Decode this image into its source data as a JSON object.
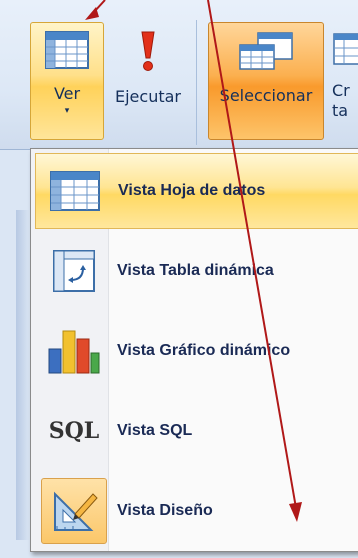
{
  "ribbon": {
    "ver_label": "Ver",
    "ver_dropdown_icon": "▾",
    "ejecutar_label": "Ejecutar",
    "seleccionar_label": "Seleccionar",
    "cr_line1": "Cr",
    "cr_line2": "ta"
  },
  "menu": {
    "items": [
      {
        "label": "Vista Hoja de datos",
        "icon": "datasheet-icon"
      },
      {
        "label": "Vista Tabla dinámica",
        "icon": "pivot-table-icon"
      },
      {
        "label": "Vista Gráfico dinámico",
        "icon": "pivot-chart-icon"
      },
      {
        "label": "Vista SQL",
        "icon": "sql-icon",
        "icon_text": "SQL"
      },
      {
        "label": "Vista Diseño",
        "icon": "design-view-icon"
      }
    ]
  },
  "colors": {
    "annotation_arrow": "#b01818",
    "highlight": "#ffd963",
    "menu_text": "#1a2a55"
  }
}
